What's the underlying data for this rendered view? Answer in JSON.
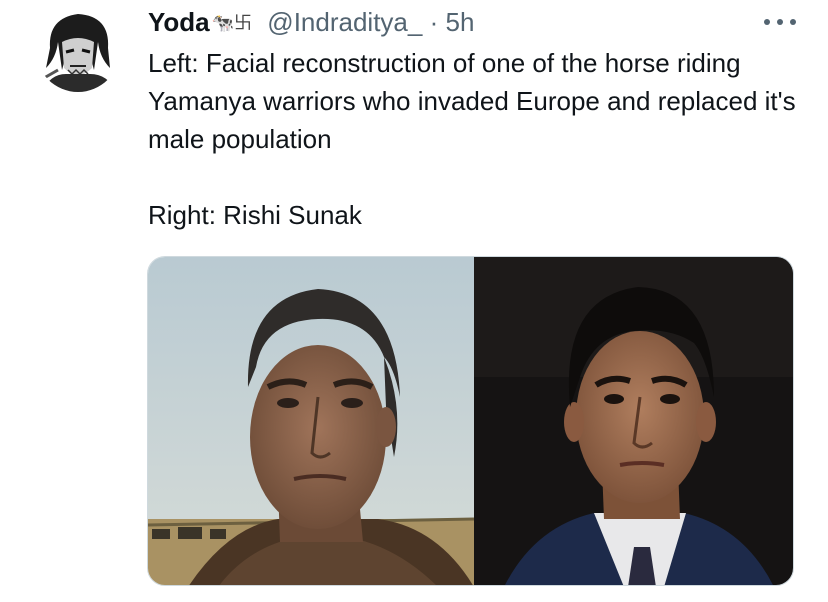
{
  "tweet": {
    "author_name": "Yoda",
    "author_emoji": "🐄卐",
    "handle": "@Indraditya_",
    "separator": "·",
    "time": "5h",
    "text_line1": "Left: Facial reconstruction of one of the horse riding Yamanya warriors who invaded Europe and replaced it's male population",
    "text_line2": "Right: Rishi Sunak"
  },
  "icons": {
    "more": "more-horizontal-icon",
    "avatar": "user-avatar"
  },
  "colors": {
    "text_primary": "#0f1419",
    "text_secondary": "#536471",
    "border": "#cfd9de"
  }
}
